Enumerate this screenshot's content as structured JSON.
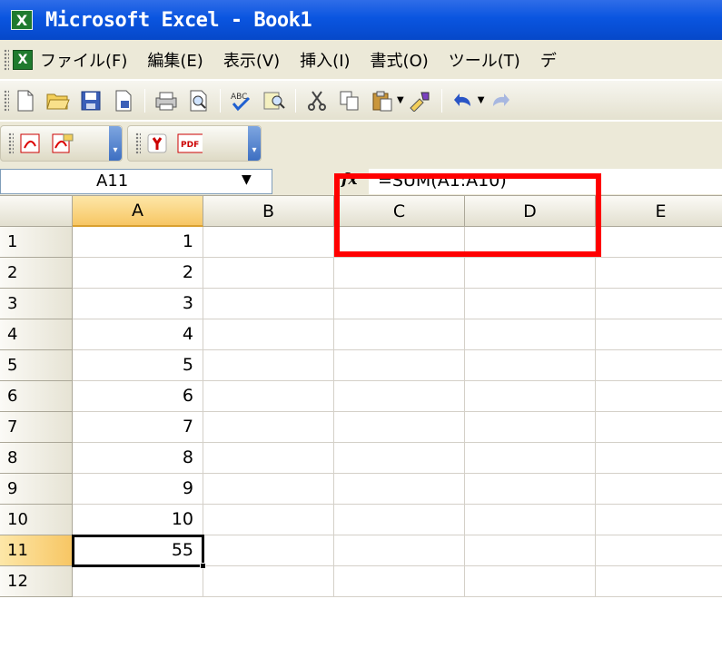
{
  "window": {
    "title": "Microsoft Excel - Book1"
  },
  "menu": {
    "items": [
      "ファイル(F)",
      "編集(E)",
      "表示(V)",
      "挿入(I)",
      "書式(O)",
      "ツール(T)",
      "デ"
    ]
  },
  "toolbar": {
    "icons": [
      "new-icon",
      "open-icon",
      "save-icon",
      "permission-icon",
      "print-icon",
      "print-preview-icon",
      "spelling-icon",
      "research-icon",
      "cut-icon",
      "copy-icon",
      "paste-icon",
      "format-painter-icon",
      "undo-icon",
      "redo-icon"
    ]
  },
  "toolbar2": {
    "pdf_label": "PDF"
  },
  "formula_bar": {
    "name_box": "A11",
    "fx": "fx",
    "formula": "=SUM(A1:A10)"
  },
  "sheet": {
    "columns": [
      "A",
      "B",
      "C",
      "D",
      "E"
    ],
    "rows": [
      {
        "num": "1",
        "a": "1"
      },
      {
        "num": "2",
        "a": "2"
      },
      {
        "num": "3",
        "a": "3"
      },
      {
        "num": "4",
        "a": "4"
      },
      {
        "num": "5",
        "a": "5"
      },
      {
        "num": "6",
        "a": "6"
      },
      {
        "num": "7",
        "a": "7"
      },
      {
        "num": "8",
        "a": "8"
      },
      {
        "num": "9",
        "a": "9"
      },
      {
        "num": "10",
        "a": "10"
      },
      {
        "num": "11",
        "a": "55"
      },
      {
        "num": "12",
        "a": ""
      }
    ],
    "active_cell": "A11"
  },
  "colors": {
    "highlight": "#ff0000",
    "title_bar": "#0a55e0",
    "selected_header": "#f7c664"
  }
}
